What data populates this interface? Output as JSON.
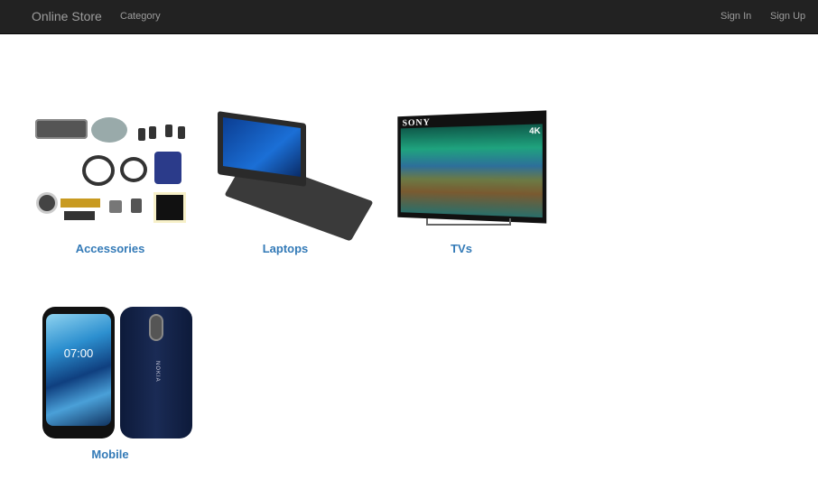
{
  "navbar": {
    "brand": "Online Store",
    "category": "Category",
    "sign_in": "Sign In",
    "sign_up": "Sign Up"
  },
  "categories": [
    {
      "label": "Accessories",
      "image": "accessories-collage"
    },
    {
      "label": "Laptops",
      "image": "laptop"
    },
    {
      "label": "TVs",
      "image": "tv"
    },
    {
      "label": "Mobile",
      "image": "smartphone"
    }
  ],
  "tv": {
    "logo": "SONY",
    "badge": "4K"
  },
  "phone": {
    "time": "07:00",
    "brand": "NOKIA"
  },
  "colors": {
    "navbar": "#222222",
    "link": "#337ab7",
    "nav_text": "#9d9d9d"
  }
}
